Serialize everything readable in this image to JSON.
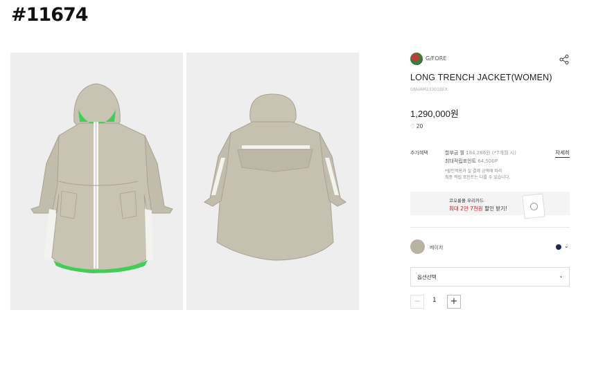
{
  "listing_id": "#11674",
  "product": {
    "brand": "G/FORE",
    "title": "LONG TRENCH JACKET(WOMEN)",
    "code": "GNUAM23301BEX",
    "price": "1,290,000원",
    "likes": "20"
  },
  "benefits": {
    "label": "추가혜택",
    "installment_text": "할부금 월",
    "installment_amount": "184,286원",
    "installment_note": "(*7개월 시)",
    "points_text": "최대적립포인트",
    "points_amount": "64,500P",
    "note_line1": "*할인적용과 실 결제 금액에 따라",
    "note_line2": "최종 적립 포인트는 다를 수 있습니다.",
    "detail_link": "자세히"
  },
  "banner": {
    "line1": "코오롱몰 우리카드",
    "line2_red": "최대 2만 7천원",
    "line2_rest": "할인 받기!"
  },
  "color_option": {
    "name": "베이지",
    "swatch_color": "#b9b3a4",
    "alt_color": "#1f2750"
  },
  "option_select": {
    "label": "옵션선택"
  },
  "quantity": {
    "value": "1",
    "minus": "−",
    "plus": "+"
  },
  "icons": {
    "share": "share-icon",
    "heart": "heart-icon",
    "chevron": "chevron-down-icon"
  }
}
